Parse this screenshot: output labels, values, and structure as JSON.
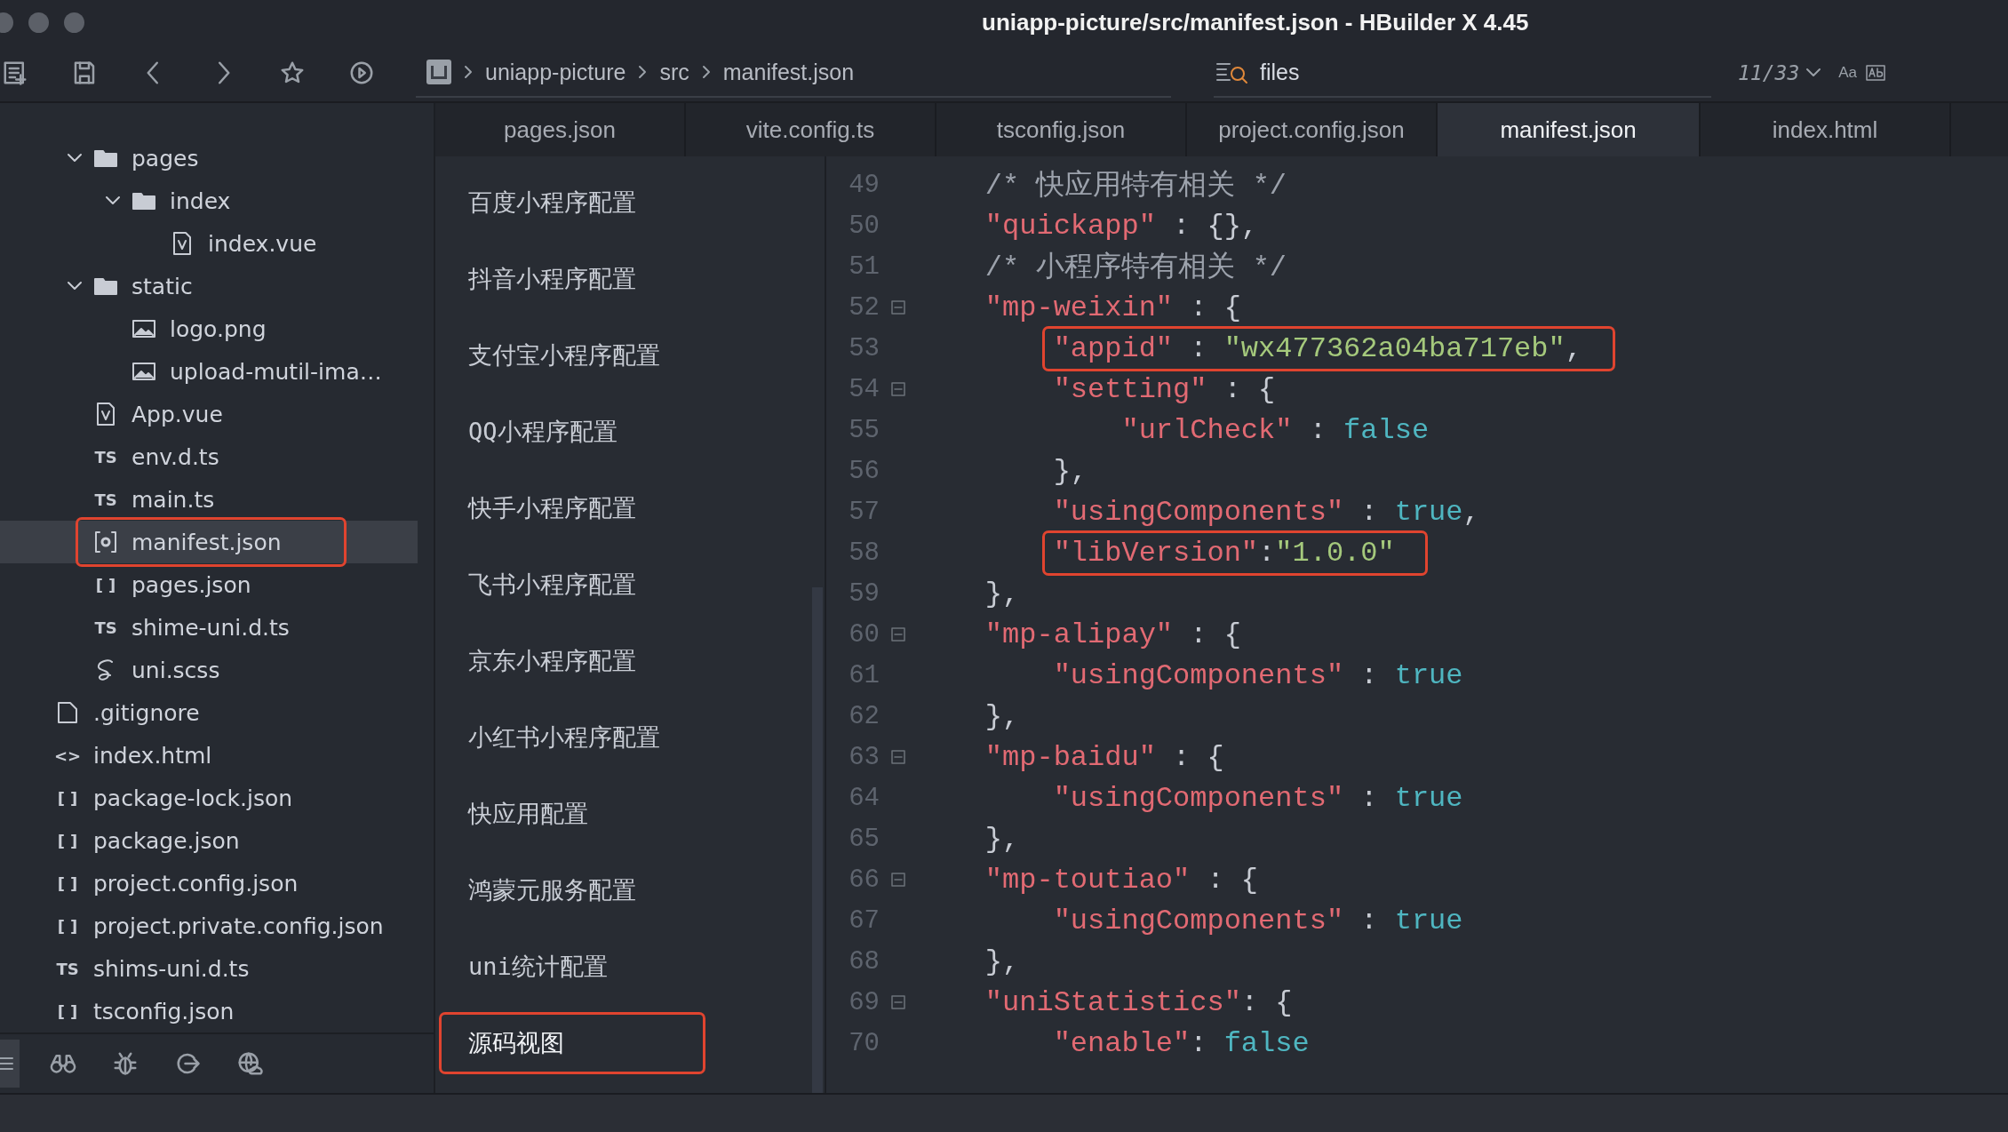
{
  "window": {
    "title": "uniapp-picture/src/manifest.json - HBuilder X 4.45"
  },
  "toolbar": {
    "breadcrumb": [
      "uniapp-picture",
      "src",
      "manifest.json"
    ],
    "search": {
      "value": "files"
    },
    "match_count": "11/33",
    "case_toggle": "Aa"
  },
  "tabs": [
    {
      "label": "pages.json",
      "selected": false
    },
    {
      "label": "vite.config.ts",
      "selected": false
    },
    {
      "label": "tsconfig.json",
      "selected": false
    },
    {
      "label": "project.config.json",
      "selected": false
    },
    {
      "label": "manifest.json",
      "selected": true
    },
    {
      "label": "index.html",
      "selected": false
    }
  ],
  "tree": [
    {
      "children": [
        {
          "label": "pages",
          "kind": "folder",
          "expanded": true,
          "selected": false,
          "highlighted": false,
          "children": [
            {
              "label": "index",
              "kind": "folder",
              "expanded": true,
              "selected": false,
              "highlighted": false,
              "children": [
                {
                  "label": "index.vue",
                  "kind": "vue",
                  "selected": false,
                  "highlighted": false
                }
              ]
            }
          ]
        },
        {
          "label": "static",
          "kind": "folder",
          "expanded": true,
          "selected": false,
          "highlighted": false,
          "children": [
            {
              "label": "logo.png",
              "kind": "image",
              "selected": false,
              "highlighted": false
            },
            {
              "label": "upload-mutil-ima…",
              "kind": "image",
              "selected": false,
              "highlighted": false
            }
          ]
        },
        {
          "label": "App.vue",
          "kind": "vue",
          "selected": false,
          "highlighted": false
        },
        {
          "label": "env.d.ts",
          "kind": "text",
          "icon_text": "TS",
          "selected": false,
          "highlighted": false
        },
        {
          "label": "main.ts",
          "kind": "text",
          "icon_text": "TS",
          "selected": false,
          "highlighted": false
        },
        {
          "label": "manifest.json",
          "kind": "settings",
          "selected": true,
          "highlighted": true
        },
        {
          "label": "pages.json",
          "kind": "text",
          "icon_text": "[ ]",
          "selected": false,
          "highlighted": false
        },
        {
          "label": "shime-uni.d.ts",
          "kind": "text",
          "icon_text": "TS",
          "selected": false,
          "highlighted": false
        },
        {
          "label": "uni.scss",
          "kind": "sass",
          "selected": false,
          "highlighted": false
        }
      ]
    },
    {
      "label": ".gitignore",
      "kind": "file",
      "selected": false,
      "highlighted": false
    },
    {
      "label": "index.html",
      "kind": "text",
      "icon_text": "<>",
      "selected": false,
      "highlighted": false
    },
    {
      "label": "package-lock.json",
      "kind": "text",
      "icon_text": "[ ]",
      "selected": false,
      "highlighted": false
    },
    {
      "label": "package.json",
      "kind": "text",
      "icon_text": "[ ]",
      "selected": false,
      "highlighted": false
    },
    {
      "label": "project.config.json",
      "kind": "text",
      "icon_text": "[ ]",
      "selected": false,
      "highlighted": false
    },
    {
      "label": "project.private.config.json",
      "kind": "text",
      "icon_text": "[ ]",
      "selected": false,
      "highlighted": false
    },
    {
      "label": "shims-uni.d.ts",
      "kind": "text",
      "icon_text": "TS",
      "selected": false,
      "highlighted": false
    },
    {
      "label": "tsconfig.json",
      "kind": "text",
      "icon_text": "[ ]",
      "selected": false,
      "highlighted": false
    }
  ],
  "settings_nav": [
    {
      "label": "百度小程序配置",
      "highlighted": false
    },
    {
      "label": "抖音小程序配置",
      "highlighted": false
    },
    {
      "label": "支付宝小程序配置",
      "highlighted": false
    },
    {
      "label": "QQ小程序配置",
      "highlighted": false
    },
    {
      "label": "快手小程序配置",
      "highlighted": false
    },
    {
      "label": "飞书小程序配置",
      "highlighted": false
    },
    {
      "label": "京东小程序配置",
      "highlighted": false
    },
    {
      "label": "小红书小程序配置",
      "highlighted": false
    },
    {
      "label": "快应用配置",
      "highlighted": false
    },
    {
      "label": "鸿蒙元服务配置",
      "highlighted": false
    },
    {
      "label": "uni统计配置",
      "highlighted": false
    },
    {
      "label": "源码视图",
      "highlighted": true
    }
  ],
  "editor": {
    "lines": [
      {
        "number": "49",
        "fold": false,
        "highlighted": false,
        "tokens": [
          {
            "kind": "comment",
            "text": "    /* 快应用特有相关 */"
          }
        ]
      },
      {
        "number": "50",
        "fold": false,
        "highlighted": false,
        "tokens": [
          {
            "kind": "key",
            "text": "    \"quickapp\""
          },
          {
            "kind": "punct",
            "text": " : {},"
          }
        ]
      },
      {
        "number": "51",
        "fold": false,
        "highlighted": false,
        "tokens": [
          {
            "kind": "comment",
            "text": "    /* 小程序特有相关 */"
          }
        ]
      },
      {
        "number": "52",
        "fold": true,
        "highlighted": false,
        "tokens": [
          {
            "kind": "key",
            "text": "    \"mp-weixin\""
          },
          {
            "kind": "punct",
            "text": " : {"
          }
        ]
      },
      {
        "number": "53",
        "fold": false,
        "highlighted": true,
        "tokens": [
          {
            "kind": "key",
            "text": "        \"appid\""
          },
          {
            "kind": "punct",
            "text": " : "
          },
          {
            "kind": "string",
            "text": "\"wx477362a04ba717eb\""
          },
          {
            "kind": "punct",
            "text": ","
          }
        ]
      },
      {
        "number": "54",
        "fold": true,
        "highlighted": false,
        "tokens": [
          {
            "kind": "key",
            "text": "        \"setting\""
          },
          {
            "kind": "punct",
            "text": " : {"
          }
        ]
      },
      {
        "number": "55",
        "fold": false,
        "highlighted": false,
        "tokens": [
          {
            "kind": "key",
            "text": "            \"urlCheck\""
          },
          {
            "kind": "punct",
            "text": " : "
          },
          {
            "kind": "literal",
            "text": "false"
          }
        ]
      },
      {
        "number": "56",
        "fold": false,
        "highlighted": false,
        "tokens": [
          {
            "kind": "punct",
            "text": "        },"
          }
        ]
      },
      {
        "number": "57",
        "fold": false,
        "highlighted": false,
        "tokens": [
          {
            "kind": "key",
            "text": "        \"usingComponents\""
          },
          {
            "kind": "punct",
            "text": " : "
          },
          {
            "kind": "literal",
            "text": "true"
          },
          {
            "kind": "punct",
            "text": ","
          }
        ]
      },
      {
        "number": "58",
        "fold": false,
        "highlighted": true,
        "tokens": [
          {
            "kind": "key",
            "text": "        \"libVersion\""
          },
          {
            "kind": "punct",
            "text": ":"
          },
          {
            "kind": "string",
            "text": "\"1.0.0\""
          }
        ]
      },
      {
        "number": "59",
        "fold": false,
        "highlighted": false,
        "tokens": [
          {
            "kind": "punct",
            "text": "    },"
          }
        ]
      },
      {
        "number": "60",
        "fold": true,
        "highlighted": false,
        "tokens": [
          {
            "kind": "key",
            "text": "    \"mp-alipay\""
          },
          {
            "kind": "punct",
            "text": " : {"
          }
        ]
      },
      {
        "number": "61",
        "fold": false,
        "highlighted": false,
        "tokens": [
          {
            "kind": "key",
            "text": "        \"usingComponents\""
          },
          {
            "kind": "punct",
            "text": " : "
          },
          {
            "kind": "literal",
            "text": "true"
          }
        ]
      },
      {
        "number": "62",
        "fold": false,
        "highlighted": false,
        "tokens": [
          {
            "kind": "punct",
            "text": "    },"
          }
        ]
      },
      {
        "number": "63",
        "fold": true,
        "highlighted": false,
        "tokens": [
          {
            "kind": "key",
            "text": "    \"mp-baidu\""
          },
          {
            "kind": "punct",
            "text": " : {"
          }
        ]
      },
      {
        "number": "64",
        "fold": false,
        "highlighted": false,
        "tokens": [
          {
            "kind": "key",
            "text": "        \"usingComponents\""
          },
          {
            "kind": "punct",
            "text": " : "
          },
          {
            "kind": "literal",
            "text": "true"
          }
        ]
      },
      {
        "number": "65",
        "fold": false,
        "highlighted": false,
        "tokens": [
          {
            "kind": "punct",
            "text": "    },"
          }
        ]
      },
      {
        "number": "66",
        "fold": true,
        "highlighted": false,
        "tokens": [
          {
            "kind": "key",
            "text": "    \"mp-toutiao\""
          },
          {
            "kind": "punct",
            "text": " : {"
          }
        ]
      },
      {
        "number": "67",
        "fold": false,
        "highlighted": false,
        "tokens": [
          {
            "kind": "key",
            "text": "        \"usingComponents\""
          },
          {
            "kind": "punct",
            "text": " : "
          },
          {
            "kind": "literal",
            "text": "true"
          }
        ]
      },
      {
        "number": "68",
        "fold": false,
        "highlighted": false,
        "tokens": [
          {
            "kind": "punct",
            "text": "    },"
          }
        ]
      },
      {
        "number": "69",
        "fold": true,
        "highlighted": false,
        "tokens": [
          {
            "kind": "key",
            "text": "    \"uniStatistics\""
          },
          {
            "kind": "punct",
            "text": ": {"
          }
        ]
      },
      {
        "number": "70",
        "fold": false,
        "highlighted": false,
        "tokens": [
          {
            "kind": "key",
            "text": "        \"enable\""
          },
          {
            "kind": "punct",
            "text": ": "
          },
          {
            "kind": "literal",
            "text": "false"
          }
        ]
      }
    ]
  }
}
